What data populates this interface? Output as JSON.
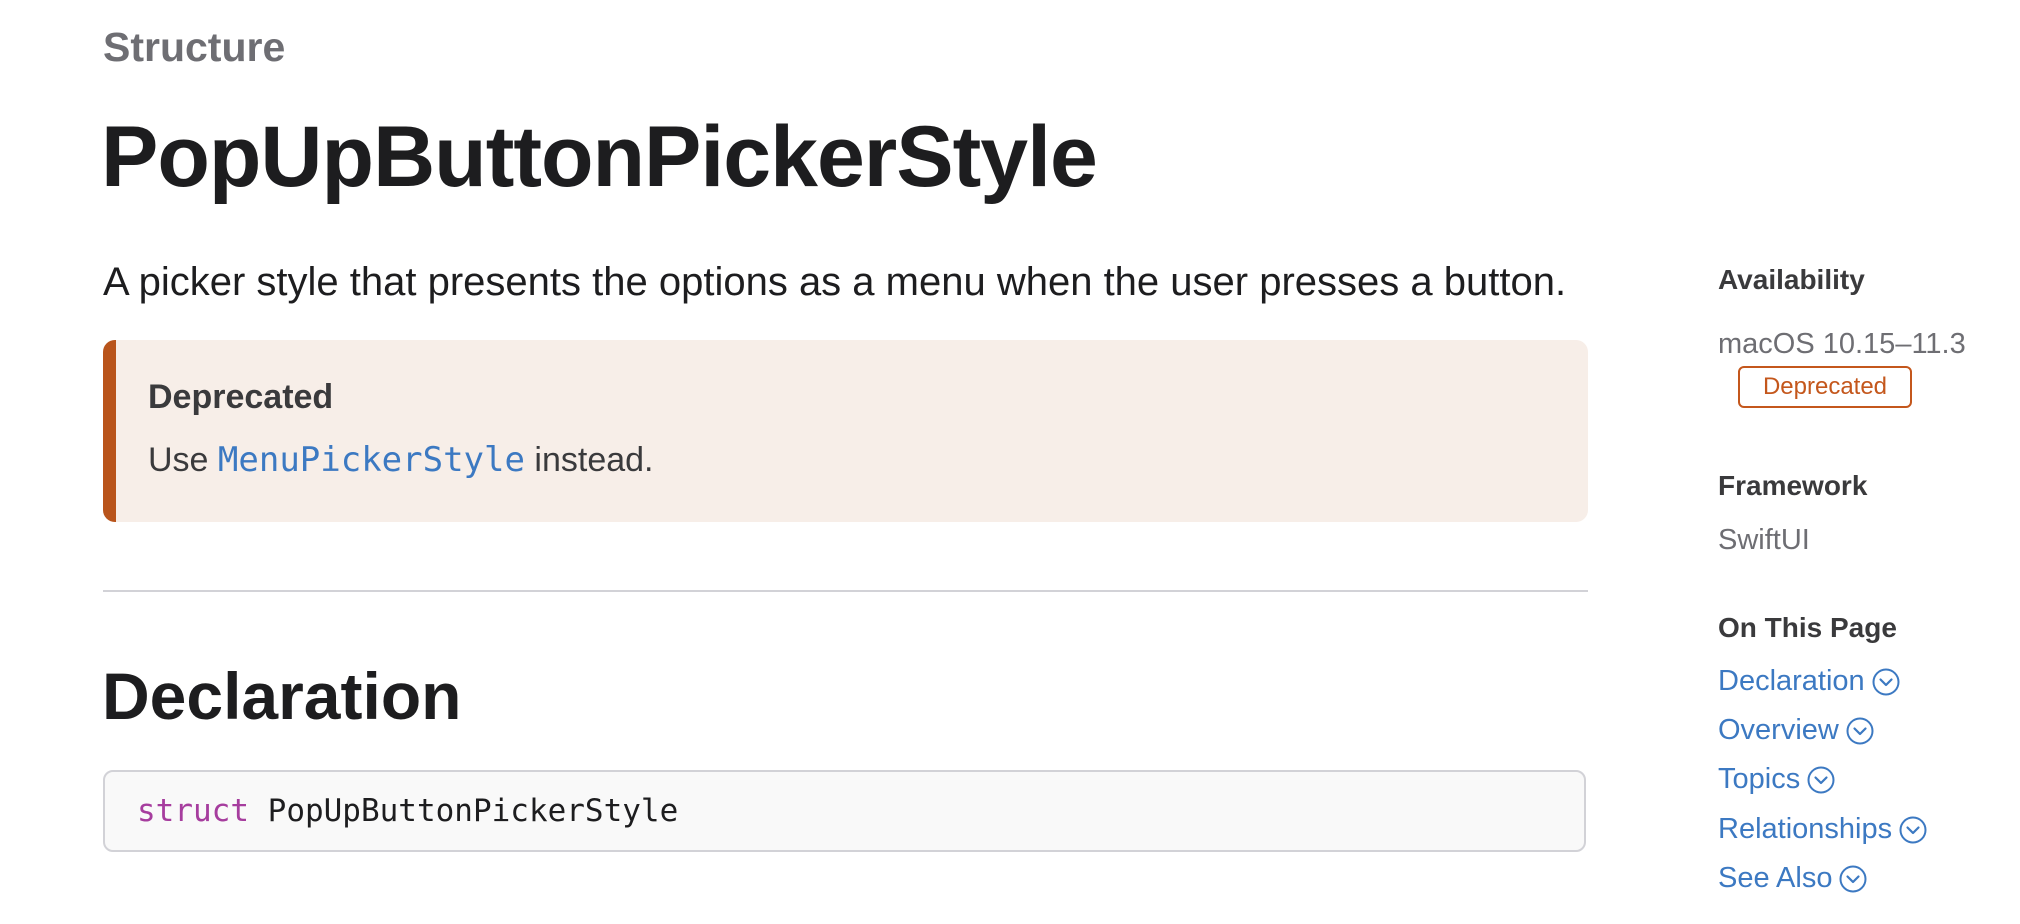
{
  "header": {
    "eyebrow": "Structure",
    "title": "PopUpButtonPickerStyle",
    "abstract": "A picker style that presents the options as a menu when the user presses a button."
  },
  "deprecation_notice": {
    "label": "Deprecated",
    "prefix": "Use ",
    "link_text": "MenuPickerStyle",
    "suffix": " instead.",
    "accent_color": "#b9541b"
  },
  "declaration": {
    "heading": "Declaration",
    "keyword": "struct",
    "identifier": "PopUpButtonPickerStyle"
  },
  "sidebar": {
    "availability": {
      "heading": "Availability",
      "platform": "macOS 10.15–11.3",
      "badge": "Deprecated"
    },
    "framework": {
      "heading": "Framework",
      "value": "SwiftUI"
    },
    "on_this_page": {
      "heading": "On This Page",
      "items": [
        {
          "label": "Declaration",
          "icon": "chevron-down-circle-icon"
        },
        {
          "label": "Overview",
          "icon": "chevron-down-circle-icon"
        },
        {
          "label": "Topics",
          "icon": "chevron-down-circle-icon"
        },
        {
          "label": "Relationships",
          "icon": "chevron-down-circle-icon"
        },
        {
          "label": "See Also",
          "icon": "chevron-down-circle-icon"
        }
      ]
    }
  },
  "colors": {
    "link": "#3c79c2",
    "keyword": "#a63d9e",
    "notice_background": "#f7eee8"
  }
}
